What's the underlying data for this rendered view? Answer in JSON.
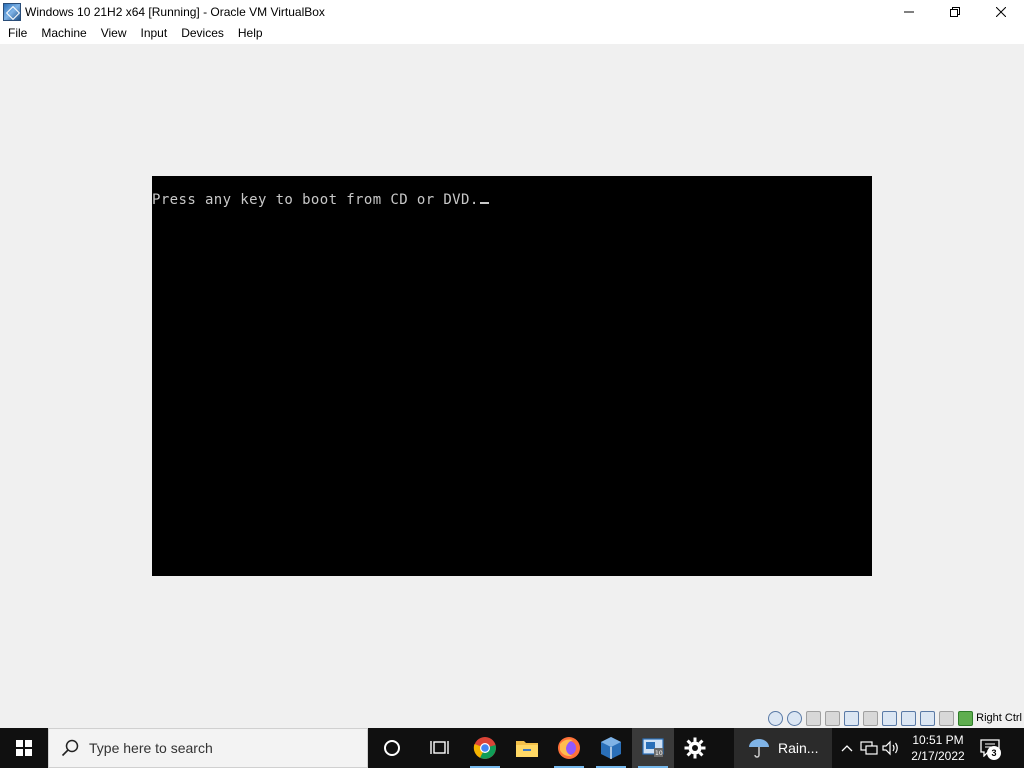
{
  "window": {
    "title": "Windows 10 21H2 x64 [Running] - Oracle VM VirtualBox",
    "controls": [
      "minimize",
      "restore",
      "close"
    ]
  },
  "menu": {
    "items": [
      "File",
      "Machine",
      "View",
      "Input",
      "Devices",
      "Help"
    ]
  },
  "vm": {
    "console_text": "Press any key to boot from CD or DVD.",
    "background": "#000000",
    "text_color": "#c8c8c8"
  },
  "statusbar": {
    "icons": [
      "hard-disk-icon",
      "optical-drive-icon",
      "audio-icon",
      "network-icon",
      "usb-icon",
      "shared-folders-icon",
      "display-icon",
      "video-capture-icon",
      "virtualization-icon",
      "mouse-integration-icon",
      "keyboard-icon"
    ],
    "host_key_label": "Right Ctrl"
  },
  "taskbar": {
    "search_placeholder": "Type here to search",
    "apps": [
      "cortana-icon",
      "task-view-icon",
      "chrome-icon",
      "file-explorer-icon",
      "firefox-icon",
      "virtualbox-icon",
      "virtualbox-vm-icon",
      "settings-icon"
    ],
    "active_app": "virtualbox-vm-icon",
    "weather_text": "Rain...",
    "time": "10:51 PM",
    "date": "2/17/2022",
    "notification_count": "3",
    "accent_color": "#76b9ed"
  }
}
